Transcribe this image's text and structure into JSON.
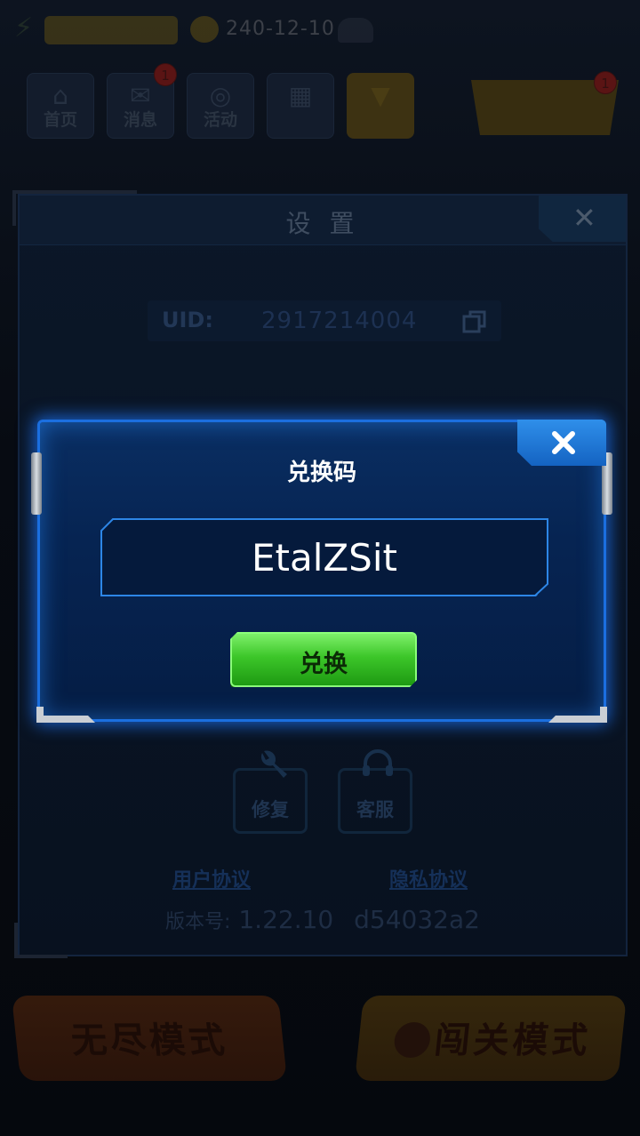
{
  "top_bar": {
    "gold_amount": "240-12-10"
  },
  "nav": {
    "items": [
      {
        "label": "首页",
        "glyph": "⌂"
      },
      {
        "label": "消息",
        "glyph": "✉",
        "badge": "1"
      },
      {
        "label": "活动",
        "glyph": "◎"
      },
      {
        "label": "",
        "glyph": "▦"
      },
      {
        "label": "",
        "glyph": "▼"
      }
    ],
    "event_badge": "1"
  },
  "settings": {
    "title": "设 置",
    "close_glyph": "✕",
    "uid_label": "UID:",
    "uid_value": "2917214004",
    "repair_label": "修复",
    "support_label": "客服",
    "user_agreement": "用户协议",
    "privacy_agreement": "隐私协议",
    "version_label": "版本号:",
    "version_value": "1.22.10",
    "build_hash": "d54032a2"
  },
  "redeem_dialog": {
    "title": "兑换码",
    "code_value": "EtalZSit",
    "redeem_button": "兑换"
  },
  "bottom_buttons": {
    "endless_mode": "无尽模式",
    "stage_mode": "闯关模式"
  },
  "colors": {
    "dialog_border": "#1b6fe0",
    "redeem_green": "#3cc629",
    "close_blue": "#2f8fea"
  }
}
